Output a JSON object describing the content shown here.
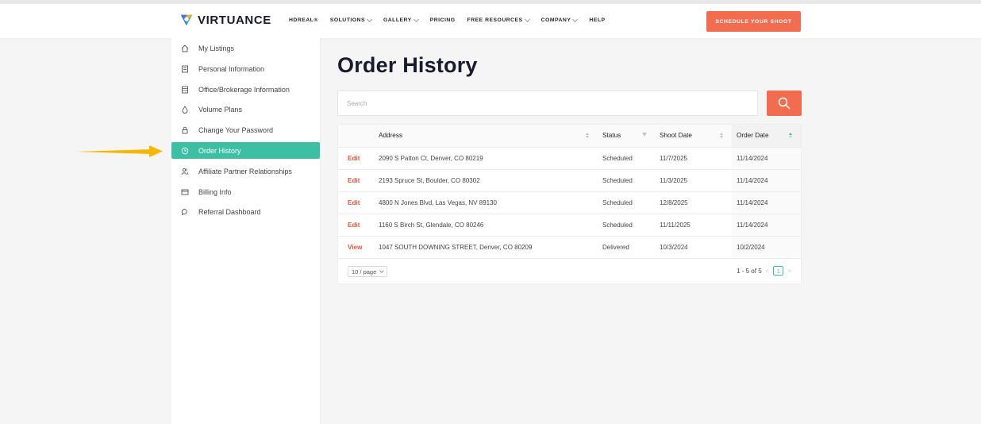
{
  "header": {
    "logo_text": "VIRTUANCE",
    "nav": [
      {
        "label": "HDREAL®",
        "has_dropdown": false
      },
      {
        "label": "SOLUTIONS",
        "has_dropdown": true
      },
      {
        "label": "GALLERY",
        "has_dropdown": true
      },
      {
        "label": "PRICING",
        "has_dropdown": false
      },
      {
        "label": "FREE RESOURCES",
        "has_dropdown": true
      },
      {
        "label": "COMPANY",
        "has_dropdown": true
      },
      {
        "label": "HELP",
        "has_dropdown": false
      }
    ],
    "cta_label": "SCHEDULE YOUR SHOOT"
  },
  "sidebar": {
    "items": [
      {
        "label": "My Listings",
        "icon": "home-icon",
        "active": false
      },
      {
        "label": "Personal Information",
        "icon": "document-icon",
        "active": false
      },
      {
        "label": "Office/Brokerage Information",
        "icon": "building-icon",
        "active": false
      },
      {
        "label": "Volume Plans",
        "icon": "droplet-icon",
        "active": false
      },
      {
        "label": "Change Your Password",
        "icon": "lock-icon",
        "active": false
      },
      {
        "label": "Order History",
        "icon": "history-icon",
        "active": true
      },
      {
        "label": "Affiliate Partner Relationships",
        "icon": "users-icon",
        "active": false
      },
      {
        "label": "Billing Info",
        "icon": "credit-card-icon",
        "active": false
      },
      {
        "label": "Referral Dashboard",
        "icon": "chat-icon",
        "active": false
      }
    ]
  },
  "main": {
    "title": "Order History",
    "search": {
      "placeholder": "Search",
      "value": ""
    },
    "table": {
      "columns": [
        "",
        "Address",
        "Status",
        "Shoot Date",
        "Order Date"
      ],
      "rows": [
        {
          "action": "Edit",
          "address": "2090 S Patton Ct, Denver, CO 80219",
          "status": "Scheduled",
          "shoot_date": "11/7/2025",
          "order_date": "11/14/2024"
        },
        {
          "action": "Edit",
          "address": "2193 Spruce St, Boulder, CO 80302",
          "status": "Scheduled",
          "shoot_date": "11/3/2025",
          "order_date": "11/14/2024"
        },
        {
          "action": "Edit",
          "address": "4800 N Jones Blvd, Las Vegas, NV 89130",
          "status": "Scheduled",
          "shoot_date": "12/8/2025",
          "order_date": "11/14/2024"
        },
        {
          "action": "Edit",
          "address": "1160 S Birch St, Glendale, CO 80246",
          "status": "Scheduled",
          "shoot_date": "11/11/2025",
          "order_date": "11/14/2024"
        },
        {
          "action": "View",
          "address": "1047 SOUTH DOWNING STREET, Denver, CO 80209",
          "status": "Delivered",
          "shoot_date": "10/3/2024",
          "order_date": "10/2/2024"
        }
      ]
    },
    "pagination": {
      "page_size": "10 / page",
      "range": "1 - 5 of 5",
      "current_page": "1"
    }
  },
  "colors": {
    "accent": "#f26c4f",
    "active": "#3dbfa4",
    "arrow": "#f5b800"
  }
}
